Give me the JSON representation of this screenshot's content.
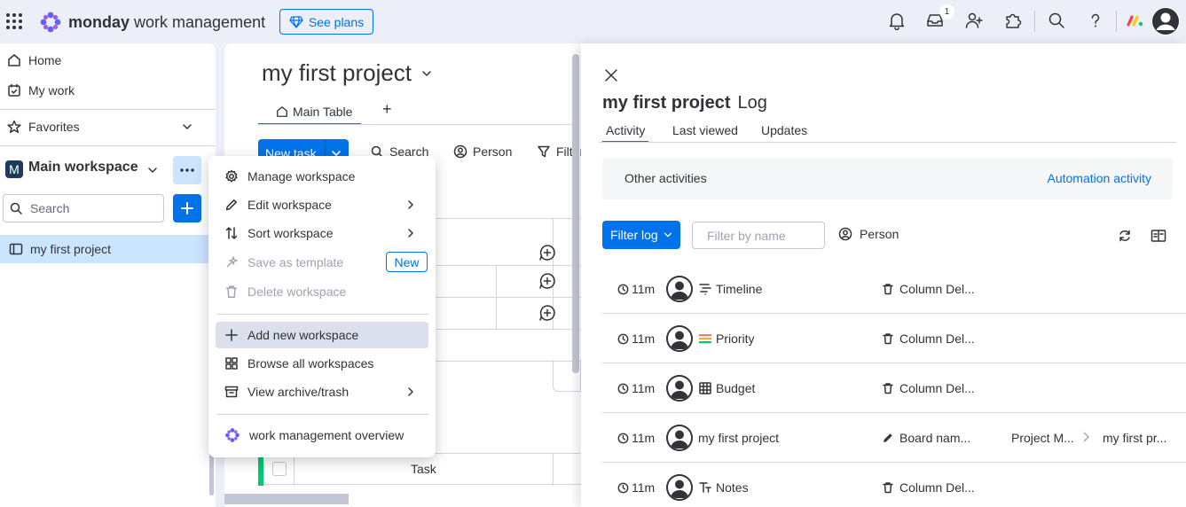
{
  "topbar": {
    "brand_strong": "monday",
    "brand_light": "work management",
    "see_plans": "See plans",
    "inbox_count": "1"
  },
  "sidebar": {
    "home": "Home",
    "my_work": "My work",
    "favorites": "Favorites",
    "workspace_initial": "M",
    "workspace_name": "Main workspace",
    "search_placeholder": "Search",
    "board": "my first project"
  },
  "board": {
    "title": "my first project",
    "tab": "Main Table",
    "add_tab": "+",
    "new_task": "New task",
    "search": "Search",
    "person": "Person",
    "filter": "Filter",
    "task_label": "Task"
  },
  "menu": {
    "items": [
      {
        "label": "Manage workspace"
      },
      {
        "label": "Edit workspace"
      },
      {
        "label": "Sort workspace"
      },
      {
        "label": "Save as template",
        "badge": "New"
      },
      {
        "label": "Delete workspace"
      },
      {
        "label": "Add new workspace"
      },
      {
        "label": "Browse all workspaces"
      },
      {
        "label": "View archive/trash"
      },
      {
        "label": "work management overview"
      }
    ]
  },
  "panel": {
    "title": "my first project",
    "subtitle": "Log",
    "tabs": [
      "Activity",
      "Last viewed",
      "Updates"
    ],
    "other_activities": "Other activities",
    "automation_activity": "Automation activity",
    "filter_log": "Filter log",
    "filter_placeholder": "Filter by name",
    "person": "Person",
    "rows": [
      {
        "time": "11m",
        "item": "Timeline",
        "item_icon": "timeline-column-icon",
        "action": "Column Del...",
        "action_icon": "trash-icon",
        "from": "",
        "to": ""
      },
      {
        "time": "11m",
        "item": "Priority",
        "item_icon": "priority-column-icon",
        "action": "Column Del...",
        "action_icon": "trash-icon",
        "from": "",
        "to": ""
      },
      {
        "time": "11m",
        "item": "Budget",
        "item_icon": "numbers-column-icon",
        "action": "Column Del...",
        "action_icon": "trash-icon",
        "from": "",
        "to": ""
      },
      {
        "time": "11m",
        "item": "my first project",
        "item_icon": "",
        "action": "Board nam...",
        "action_icon": "pencil-icon",
        "from": "Project M...",
        "to": "my first pr..."
      },
      {
        "time": "11m",
        "item": "Notes",
        "item_icon": "text-column-icon",
        "action": "Column Del...",
        "action_icon": "trash-icon",
        "from": "",
        "to": ""
      }
    ]
  },
  "colors": {
    "primary": "#0073ea",
    "selected_bg": "#cce5ff",
    "group_green": "#00c875",
    "topbar_bg": "#eceff8"
  }
}
